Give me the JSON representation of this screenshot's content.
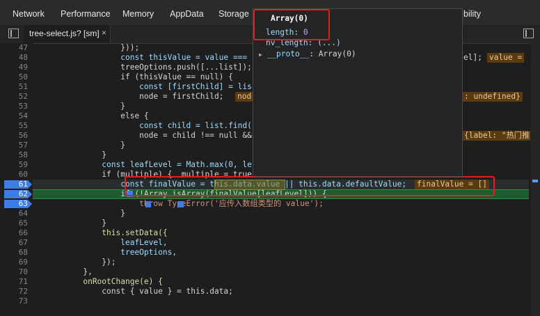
{
  "devtools_tabs": [
    "Network",
    "Performance",
    "Memory",
    "AppData",
    "Storage",
    "bility"
  ],
  "file_tab": {
    "name": "tree-select.js? [sm]",
    "close": "×"
  },
  "line_numbers": [
    "47",
    "48",
    "49",
    "50",
    "51",
    "52",
    "53",
    "54",
    "55",
    "56",
    "57",
    "58",
    "59",
    "60",
    "61",
    "62",
    "63",
    "64",
    "65",
    "66",
    "67",
    "68",
    "69",
    "70",
    "71",
    "72",
    "73"
  ],
  "breakpoint_lines": [
    "61",
    "62",
    "63"
  ],
  "code_lines": [
    "                  }));",
    "                  const thisValue = value ===",
    "                  treeOptions.push([...list]);",
    "                  if (thisValue == null) {",
    "                      const [firstChild] = lis",
    "                      node = firstChild;",
    "                  }",
    "                  else {",
    "                      const child = list.find(",
    "                      node = child !== null &&",
    "                  }",
    "              }",
    "              const leafLevel = Math.max(0, le",
    "              if (multiple) {  multiple = true",
    "                  const finalValue = this.data.value || this.data.defaultValue;",
    "                  if (!Array.isArray(finalValue[leafLevel])) {",
    "                      throw TypeError('应传入数组类型的 value');",
    "                  }",
    "              }",
    "              this.setData({",
    "                  leafLevel,",
    "                  treeOptions,",
    "              });",
    "          },",
    "          onRootChange(e) {",
    "              const { value } = this.data;",
    ""
  ],
  "inline_values": {
    "line48_tail": "el];",
    "line48_value": "value =",
    "line52_node": "nod",
    "line52_tail": ": undefined}",
    "line56_tail": "{label: \"热门推",
    "line61_value": "finalValue = []"
  },
  "tooltip": {
    "title": "Array(0)",
    "length_label": "length",
    "length_value": "0",
    "nv_length": "nv_length: (...)",
    "proto_label": "__proto__",
    "proto_value": "Array(0)"
  },
  "colors": {
    "accent_red": "#e02020",
    "breakpoint_blue": "#3e7ce8",
    "paused_line_green": "#1d5c2e"
  }
}
